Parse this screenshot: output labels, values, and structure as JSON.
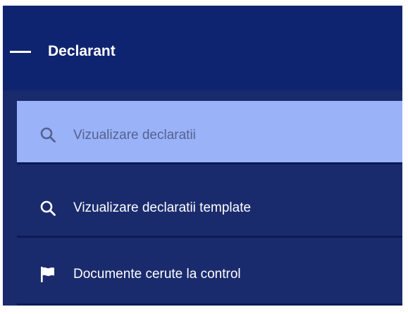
{
  "section": {
    "title": "Declarant",
    "collapse_icon": "minus-icon"
  },
  "menu": {
    "items": [
      {
        "label": "Vizualizare declaratii",
        "icon": "search-icon",
        "active": true
      },
      {
        "label": "Vizualizare declaratii template",
        "icon": "search-icon",
        "active": false
      },
      {
        "label": "Documente cerute la control",
        "icon": "flag-icon",
        "active": false
      }
    ]
  },
  "colors": {
    "header_bg": "#0f2470",
    "panel_bg": "#1a2b6d",
    "active_bg": "#99b2f8",
    "active_text": "#566290",
    "text": "#ffffff"
  }
}
